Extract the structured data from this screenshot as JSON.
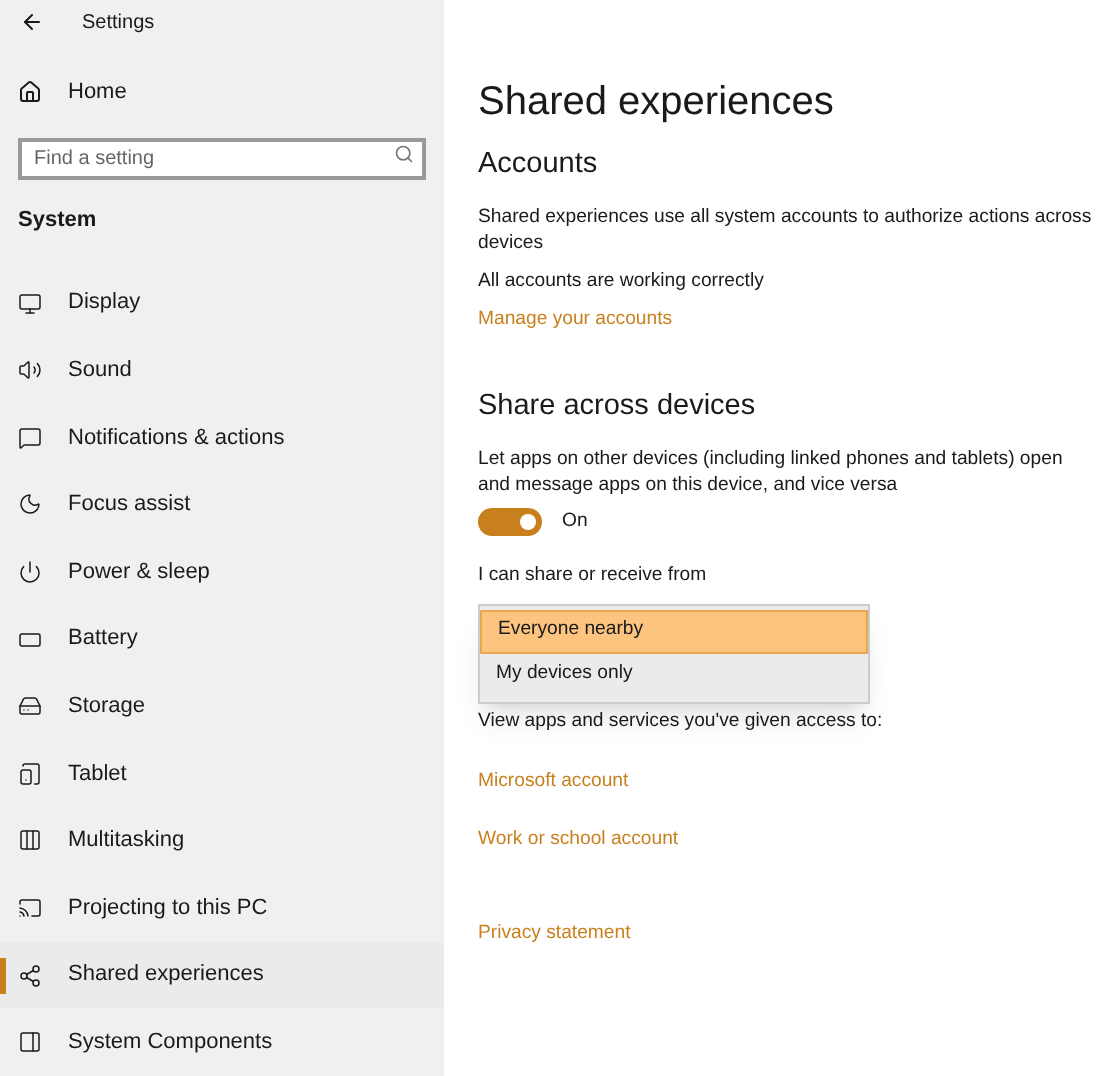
{
  "window": {
    "title": "Settings"
  },
  "sidebar": {
    "home": "Home",
    "search": {
      "placeholder": "Find a setting"
    },
    "section": "System",
    "items": [
      {
        "label": "Display",
        "selected": false
      },
      {
        "label": "Sound",
        "selected": false
      },
      {
        "label": "Notifications & actions",
        "selected": false
      },
      {
        "label": "Focus assist",
        "selected": false
      },
      {
        "label": "Power & sleep",
        "selected": false
      },
      {
        "label": "Battery",
        "selected": false
      },
      {
        "label": "Storage",
        "selected": false
      },
      {
        "label": "Tablet",
        "selected": false
      },
      {
        "label": "Multitasking",
        "selected": false
      },
      {
        "label": "Projecting to this PC",
        "selected": false
      },
      {
        "label": "Shared experiences",
        "selected": true
      },
      {
        "label": "System Components",
        "selected": false
      }
    ]
  },
  "page": {
    "title": "Shared experiences",
    "accounts": {
      "heading": "Accounts",
      "description": "Shared experiences use all system accounts to authorize actions across devices",
      "status": "All accounts are working correctly",
      "link": "Manage your accounts"
    },
    "share": {
      "heading": "Share across devices",
      "description": "Let apps on other devices (including linked phones and tablets) open and message apps on this device, and vice versa",
      "toggle": {
        "on": true,
        "label": "On"
      },
      "dropdown_label": "I can share or receive from",
      "options": [
        {
          "label": "Everyone nearby",
          "selected": true
        },
        {
          "label": "My devices only",
          "selected": false
        }
      ]
    },
    "access_text": "View apps and services you've given access to:",
    "links": [
      "Microsoft account",
      "Work or school account"
    ],
    "privacy": "Privacy statement"
  }
}
